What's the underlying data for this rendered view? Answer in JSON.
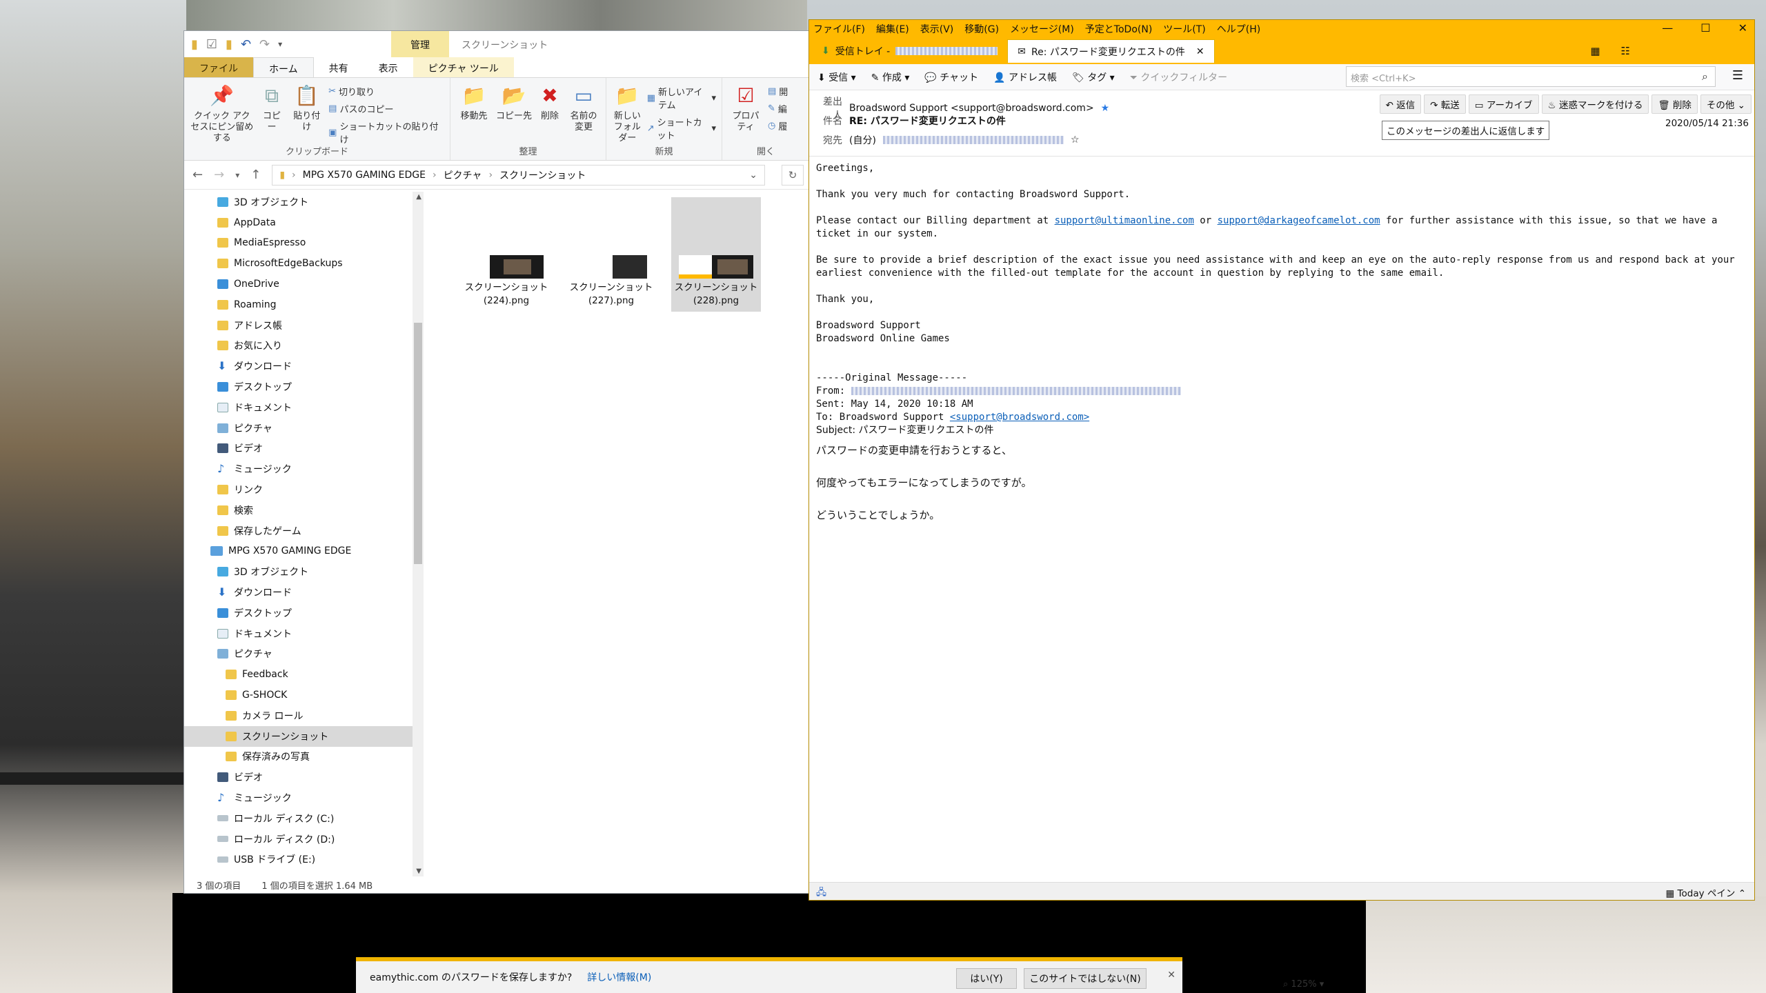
{
  "explorer": {
    "window_title": "スクリーンショット",
    "ribbon_tabs": {
      "file": "ファイル",
      "home": "ホーム",
      "share": "共有",
      "view": "表示",
      "manage": "管理",
      "picture_tools": "ピクチャ ツール"
    },
    "ribbon": {
      "pin": "クイック アクセスにピン留めする",
      "copy": "コピー",
      "paste": "貼り付け",
      "cut": "切り取り",
      "copy_path": "パスのコピー",
      "paste_shortcut": "ショートカットの貼り付け",
      "clipboard_group": "クリップボード",
      "move_to": "移動先",
      "copy_to": "コピー先",
      "delete": "削除",
      "rename": "名前の変更",
      "organize_group": "整理",
      "new_folder": "新しいフォルダー",
      "new_item": "新しいアイテム",
      "shortcut": "ショートカット",
      "new_group": "新規",
      "properties": "プロパティ",
      "open_group": "開く",
      "open_sub1": "開",
      "open_sub2": "編",
      "open_sub3": "履"
    },
    "breadcrumb": [
      "MPG X570 GAMING EDGE",
      "ピクチャ",
      "スクリーンショット"
    ],
    "nav_items": [
      {
        "label": "3D オブジェクト",
        "icon": "cube-icon",
        "indent": 1
      },
      {
        "label": "AppData",
        "icon": "folder-icon",
        "indent": 1
      },
      {
        "label": "MediaEspresso",
        "icon": "folder-icon",
        "indent": 1
      },
      {
        "label": "MicrosoftEdgeBackups",
        "icon": "folder-icon",
        "indent": 1
      },
      {
        "label": "OneDrive",
        "icon": "cloud-icon",
        "indent": 1
      },
      {
        "label": "Roaming",
        "icon": "folder-icon",
        "indent": 1
      },
      {
        "label": "アドレス帳",
        "icon": "folder-icon",
        "indent": 1
      },
      {
        "label": "お気に入り",
        "icon": "folder-icon",
        "indent": 1
      },
      {
        "label": "ダウンロード",
        "icon": "download-icon",
        "indent": 1
      },
      {
        "label": "デスクトップ",
        "icon": "desktop-icon",
        "indent": 1
      },
      {
        "label": "ドキュメント",
        "icon": "document-icon",
        "indent": 1
      },
      {
        "label": "ピクチャ",
        "icon": "pictures-icon",
        "indent": 1
      },
      {
        "label": "ビデオ",
        "icon": "video-icon",
        "indent": 1
      },
      {
        "label": "ミュージック",
        "icon": "music-icon",
        "indent": 1
      },
      {
        "label": "リンク",
        "icon": "link-icon",
        "indent": 1
      },
      {
        "label": "検索",
        "icon": "search-folder-icon",
        "indent": 1
      },
      {
        "label": "保存したゲーム",
        "icon": "games-icon",
        "indent": 1
      },
      {
        "label": "MPG X570 GAMING EDGE",
        "icon": "pc-icon",
        "indent": 0
      },
      {
        "label": "3D オブジェクト",
        "icon": "cube-icon",
        "indent": 1
      },
      {
        "label": "ダウンロード",
        "icon": "download-icon",
        "indent": 1
      },
      {
        "label": "デスクトップ",
        "icon": "desktop-icon",
        "indent": 1
      },
      {
        "label": "ドキュメント",
        "icon": "document-icon",
        "indent": 1
      },
      {
        "label": "ピクチャ",
        "icon": "pictures-icon",
        "indent": 1
      },
      {
        "label": "Feedback",
        "icon": "folder-icon",
        "indent": 2
      },
      {
        "label": "G-SHOCK",
        "icon": "folder-icon",
        "indent": 2
      },
      {
        "label": "カメラ ロール",
        "icon": "folder-icon",
        "indent": 2
      },
      {
        "label": "スクリーンショット",
        "icon": "folder-icon",
        "indent": 2,
        "selected": true
      },
      {
        "label": "保存済みの写真",
        "icon": "folder-icon",
        "indent": 2
      },
      {
        "label": "ビデオ",
        "icon": "video-icon",
        "indent": 1
      },
      {
        "label": "ミュージック",
        "icon": "music-icon",
        "indent": 1
      },
      {
        "label": "ローカル ディスク (C:)",
        "icon": "drive-icon",
        "indent": 1
      },
      {
        "label": "ローカル ディスク (D:)",
        "icon": "drive-icon",
        "indent": 1
      },
      {
        "label": "USB ドライブ (E:)",
        "icon": "drive-icon",
        "indent": 1
      }
    ],
    "files": [
      {
        "name": "スクリーンショット (224).png",
        "selected": false
      },
      {
        "name": "スクリーンショット (227).png",
        "selected": false
      },
      {
        "name": "スクリーンショット (228).png",
        "selected": true
      }
    ],
    "status": {
      "count": "3 個の項目",
      "selected": "1 個の項目を選択  1.64 MB"
    }
  },
  "thunderbird": {
    "menu": [
      "ファイル(F)",
      "編集(E)",
      "表示(V)",
      "移動(G)",
      "メッセージ(M)",
      "予定とToDo(N)",
      "ツール(T)",
      "ヘルプ(H)"
    ],
    "tabs": {
      "inbox": "受信トレイ - ",
      "message": "Re: パスワード変更リクエストの件"
    },
    "toolbar": {
      "receive": "受信",
      "compose": "作成",
      "chat": "チャット",
      "address_book": "アドレス帳",
      "tag": "タグ",
      "quick_filter": "クイックフィルター",
      "search_placeholder": "検索 <Ctrl+K>"
    },
    "header": {
      "from_label": "差出人",
      "from": "Broadsword Support <support@broadsword.com>",
      "subject_label": "件名",
      "subject": "RE: パスワード変更リクエストの件",
      "to_label": "宛先",
      "to": "(自分)",
      "date": "2020/05/14 21:36",
      "actions": [
        "返信",
        "転送",
        "アーカイブ",
        "迷惑マークを付ける",
        "削除",
        "その他"
      ],
      "tooltip": "このメッセージの差出人に返信します"
    },
    "body": {
      "greeting": "Greetings,",
      "p1": "Thank you very much for contacting Broadsword Support.",
      "p2_a": "Please contact our Billing department at ",
      "p2_link1": "support@ultimaonline.com",
      "p2_b": " or ",
      "p2_link2": "support@darkageofcamelot.com",
      "p2_c": " for further assistance with this issue, so that we have a ticket in our system.",
      "p3": "Be sure to provide a brief description of the exact issue you need assistance with and keep an eye on the auto-reply response from us and respond back at your earliest convenience with the filled-out template for the account in question by replying to the same email.",
      "thanks": "Thank you,",
      "sig1": "Broadsword Support",
      "sig2": "Broadsword Online Games",
      "orig_header": "-----Original Message-----",
      "orig_from": "From: ",
      "orig_sent": "Sent: May 14, 2020 10:18 AM",
      "orig_to_a": "To: Broadsword Support ",
      "orig_to_link": "<support@broadsword.com>",
      "orig_subject": "Subject: パスワード変更リクエストの件",
      "jp1": "パスワードの変更申請を行おうとすると、",
      "jp2": "何度やってもエラーになってしまうのですが。",
      "jp3": "どういうことでしょうか。"
    },
    "status_right": "Today ペイン"
  },
  "password_bar": {
    "text": "eamythic.com のパスワードを保存しますか?",
    "more": "詳しい情報(M)",
    "yes": "はい(Y)",
    "never": "このサイトではしない(N)"
  },
  "zoom": "125%",
  "colors": {
    "thunderbird_accent": "#ffb900",
    "explorer_file_tab": "#d9b44a",
    "link": "#0b5fb8"
  }
}
